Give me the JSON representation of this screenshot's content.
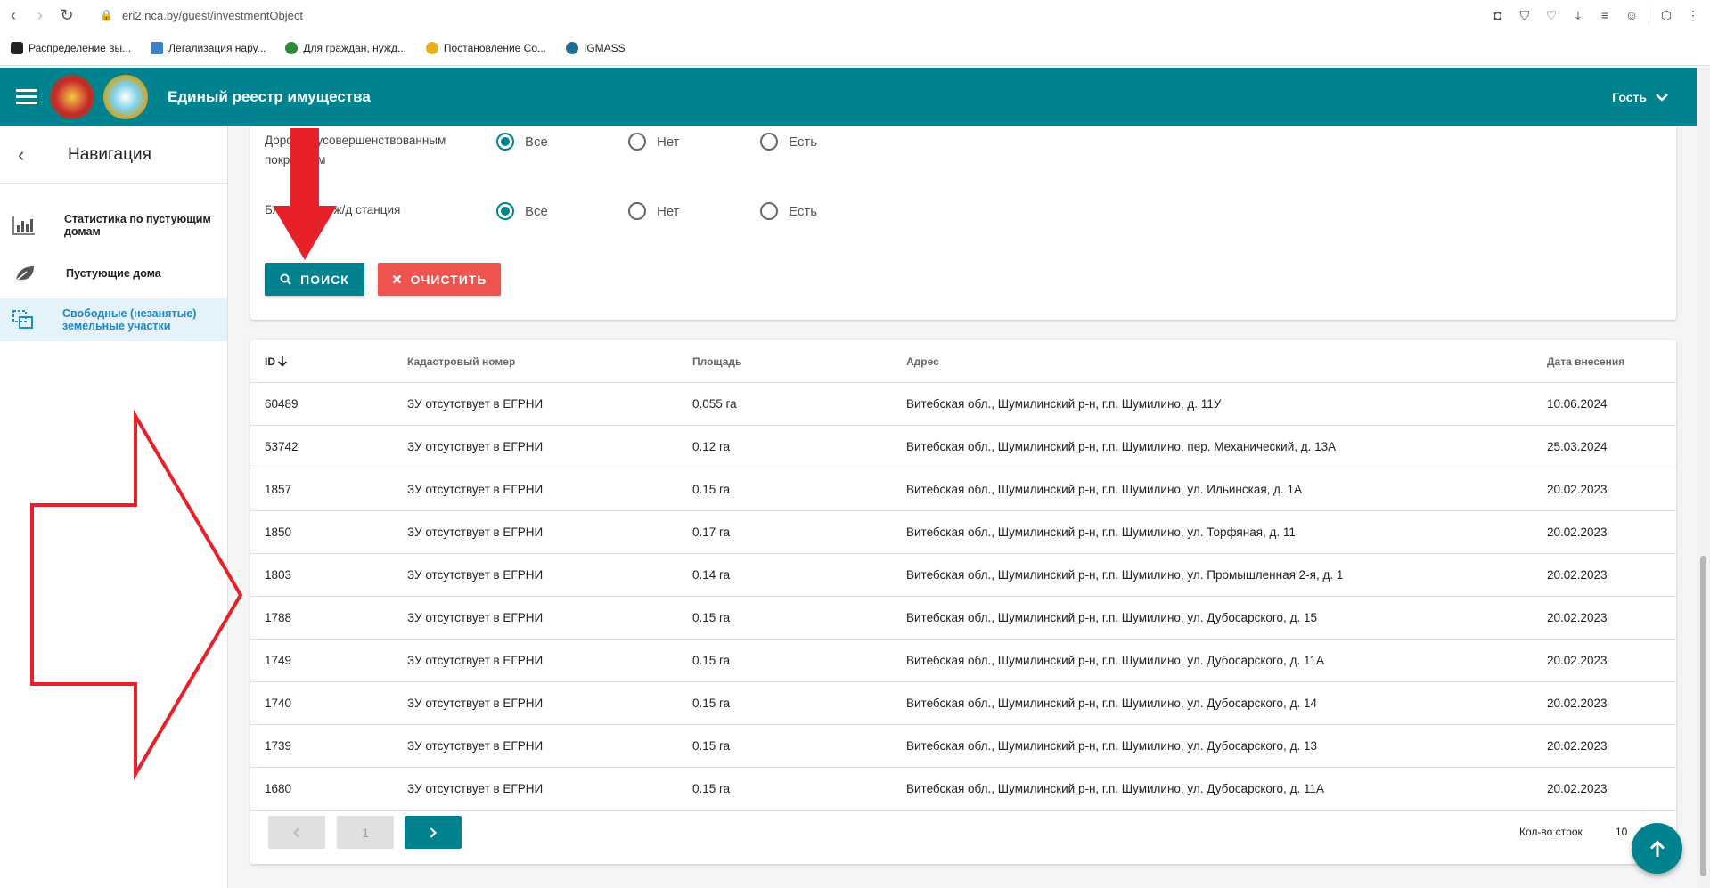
{
  "browser": {
    "url": "eri2.nca.by/guest/investmentObject",
    "bookmarks": [
      "Распределение вы...",
      "Легализация нару...",
      "Для граждан, нужд...",
      "Постановление Со...",
      "IGMASS"
    ]
  },
  "header": {
    "title": "Единый реестр имущества",
    "user": "Гость"
  },
  "sidebar": {
    "title": "Навигация",
    "items": [
      {
        "label": "Статистика по пустующим домам",
        "icon": "bar-chart-icon",
        "active": false
      },
      {
        "label": "Пустующие дома",
        "icon": "leaf-icon",
        "active": false
      },
      {
        "label": "Свободные (незанятые) земельные участки",
        "icon": "select-area-icon",
        "active": true
      }
    ]
  },
  "filters": [
    {
      "label": "Дороги с усовершенствованным покрытием",
      "options": [
        "Все",
        "Нет",
        "Есть"
      ],
      "selected": "Все"
    },
    {
      "label": "Ближайшая ж/д станция",
      "options": [
        "Все",
        "Нет",
        "Есть"
      ],
      "selected": "Все"
    }
  ],
  "buttons": {
    "search": "ПОИСК",
    "clear": "ОЧИСТИТЬ"
  },
  "table": {
    "columns": [
      "ID",
      "Кадастровый номер",
      "Площадь",
      "Адрес",
      "Дата внесения"
    ],
    "rows": [
      [
        "60489",
        "ЗУ отсутствует в ЕГРНИ",
        "0.055 га",
        "Витебская обл., Шумилинский р-н, г.п. Шумилино, д. 11У",
        "10.06.2024"
      ],
      [
        "53742",
        "ЗУ отсутствует в ЕГРНИ",
        "0.12 га",
        "Витебская обл., Шумилинский р-н, г.п. Шумилино, пер. Механический, д. 13А",
        "25.03.2024"
      ],
      [
        "1857",
        "ЗУ отсутствует в ЕГРНИ",
        "0.15 га",
        "Витебская обл., Шумилинский р-н, г.п. Шумилино, ул. Ильинская, д. 1А",
        "20.02.2023"
      ],
      [
        "1850",
        "ЗУ отсутствует в ЕГРНИ",
        "0.17 га",
        "Витебская обл., Шумилинский р-н, г.п. Шумилино, ул. Торфяная, д. 11",
        "20.02.2023"
      ],
      [
        "1803",
        "ЗУ отсутствует в ЕГРНИ",
        "0.14 га",
        "Витебская обл., Шумилинский р-н, г.п. Шумилино, ул. Промышленная 2-я, д. 1",
        "20.02.2023"
      ],
      [
        "1788",
        "ЗУ отсутствует в ЕГРНИ",
        "0.15 га",
        "Витебская обл., Шумилинский р-н, г.п. Шумилино, ул. Дубосарского, д. 15",
        "20.02.2023"
      ],
      [
        "1749",
        "ЗУ отсутствует в ЕГРНИ",
        "0.15 га",
        "Витебская обл., Шумилинский р-н, г.п. Шумилино, ул. Дубосарского, д. 11А",
        "20.02.2023"
      ],
      [
        "1740",
        "ЗУ отсутствует в ЕГРНИ",
        "0.15 га",
        "Витебская обл., Шумилинский р-н, г.п. Шумилино, ул. Дубосарского, д. 14",
        "20.02.2023"
      ],
      [
        "1739",
        "ЗУ отсутствует в ЕГРНИ",
        "0.15 га",
        "Витебская обл., Шумилинский р-н, г.п. Шумилино, ул. Дубосарского, д. 13",
        "20.02.2023"
      ],
      [
        "1680",
        "ЗУ отсутствует в ЕГРНИ",
        "0.15 га",
        "Витебская обл., Шумилинский р-н, г.п. Шумилино, ул. Дубосарского, д. 11А",
        "20.02.2023"
      ]
    ]
  },
  "pagination": {
    "page": "1",
    "rows_label": "Кол-во строк",
    "rows_value": "10"
  },
  "colors": {
    "brand": "#00838f",
    "clear": "#ef5350",
    "active_nav": "#1a88c9",
    "annotation": "#e8202a"
  }
}
